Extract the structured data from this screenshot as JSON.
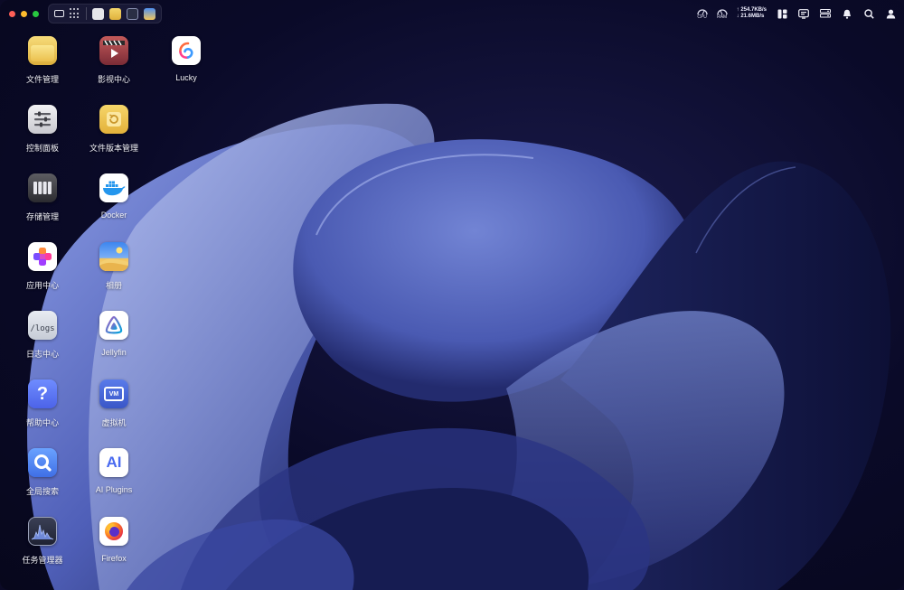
{
  "window": {
    "traffic_lights": [
      "close",
      "minimize",
      "maximize"
    ]
  },
  "topbar": {
    "left_icons": [
      "monitor-icon",
      "app-grid-icon",
      "control-panel-icon",
      "file-manager-icon",
      "task-manager-icon",
      "album-icon"
    ],
    "status": {
      "cpu_label": "CPU",
      "ram_label": "RAM",
      "upload": "254.7KB/s",
      "download": "21.6MB/s",
      "right_icons": [
        "widgets-icon",
        "terminal-icon",
        "storage-icon",
        "bell-icon",
        "search-icon",
        "user-icon"
      ]
    }
  },
  "desktop": {
    "columns": [
      [
        {
          "label": "文件管理",
          "icon": "folder-icon"
        },
        {
          "label": "控制面板",
          "icon": "control-panel-icon"
        },
        {
          "label": "存储管理",
          "icon": "storage-icon"
        },
        {
          "label": "应用中心",
          "icon": "app-center-icon"
        },
        {
          "label": "日志中心",
          "icon": "logs-icon",
          "icon_text": "/logs"
        },
        {
          "label": "帮助中心",
          "icon": "help-icon",
          "icon_text": "?"
        },
        {
          "label": "全局搜索",
          "icon": "search-icon"
        },
        {
          "label": "任务管理器",
          "icon": "task-manager-icon"
        }
      ],
      [
        {
          "label": "影视中心",
          "icon": "video-icon"
        },
        {
          "label": "文件版本管理",
          "icon": "file-version-icon"
        },
        {
          "label": "Docker",
          "icon": "docker-icon"
        },
        {
          "label": "相册",
          "icon": "album-icon"
        },
        {
          "label": "Jellyfin",
          "icon": "jellyfin-icon"
        },
        {
          "label": "虚拟机",
          "icon": "vm-icon",
          "icon_text": "VM"
        },
        {
          "label": "AI Plugins",
          "icon": "ai-icon",
          "icon_text": "AI"
        },
        {
          "label": "Firefox",
          "icon": "firefox-icon"
        }
      ],
      [
        {
          "label": "Lucky",
          "icon": "lucky-icon"
        }
      ]
    ]
  },
  "colors": {
    "background": "#0b0a26",
    "wallpaper_accent": "#5a6bc4",
    "label_text": "#f2f2f8"
  }
}
